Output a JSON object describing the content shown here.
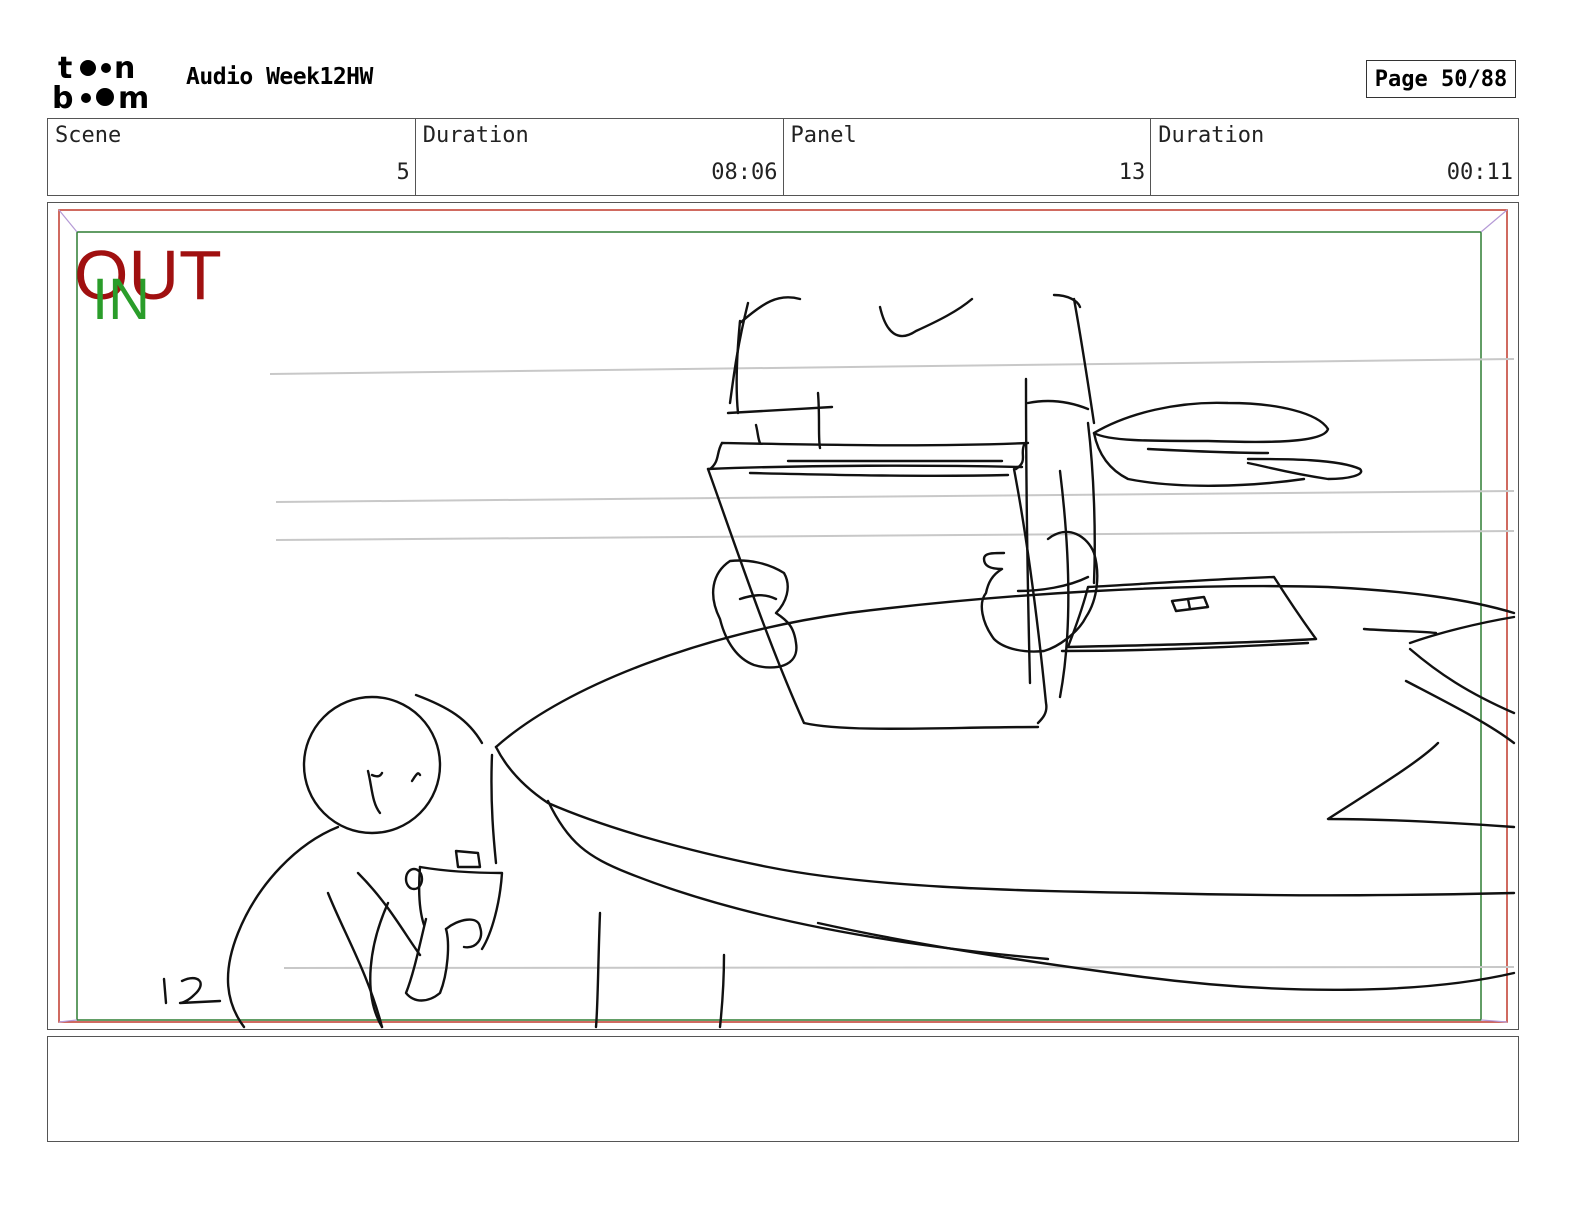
{
  "header": {
    "logo": {
      "top": "toon",
      "bottom": "boom",
      "icon": "toon-boom-logo"
    },
    "project_title": "Audio Week12HW",
    "page_label": "Page 50/88"
  },
  "info": {
    "scene_label": "Scene",
    "scene_value": "5",
    "scene_duration_label": "Duration",
    "scene_duration_value": "08:06",
    "panel_label": "Panel",
    "panel_value": "13",
    "panel_duration_label": "Duration",
    "panel_duration_value": "00:11"
  },
  "panel": {
    "out_marker": "OUT",
    "in_marker": "IN",
    "handwritten_number": "12",
    "colors": {
      "out": "#a01010",
      "in": "#2a9d2a",
      "safe_frame": "#2e7d32",
      "camera_frame": "#c0392b"
    }
  },
  "notes": {
    "text": ""
  }
}
